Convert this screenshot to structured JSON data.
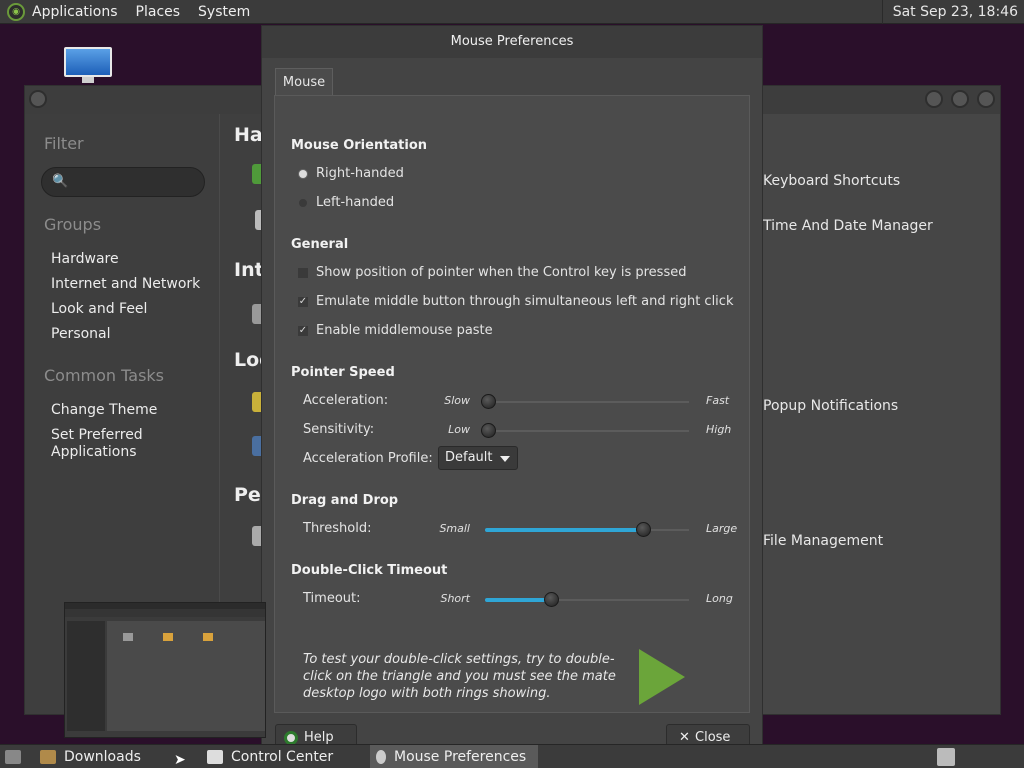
{
  "top_panel": {
    "menus": [
      "Applications",
      "Places",
      "System"
    ],
    "clock": "Sat Sep 23, 18:46"
  },
  "control_center": {
    "sidebar": {
      "filter_title": "Filter",
      "search_placeholder": "",
      "groups_title": "Groups",
      "groups": [
        "Hardware",
        "Internet and Network",
        "Look and Feel",
        "Personal"
      ],
      "common_tasks_title": "Common Tasks",
      "tasks": [
        "Change Theme",
        "Set Preferred\nApplications"
      ]
    },
    "headings": [
      "Har",
      "Inte",
      "Loo",
      "Per"
    ],
    "items": [
      "Keyboard Shortcuts",
      "Time And Date Manager",
      "Popup Notifications",
      "File Management"
    ]
  },
  "mouse_prefs": {
    "title": "Mouse Preferences",
    "tab": "Mouse",
    "orientation": {
      "title": "Mouse Orientation",
      "right": "Right-handed",
      "left": "Left-handed",
      "selected": "right"
    },
    "general": {
      "title": "General",
      "show_position": {
        "label": "Show position of pointer when the Control key is pressed",
        "checked": false
      },
      "emulate_middle": {
        "label": "Emulate middle button through simultaneous left and right click",
        "checked": true
      },
      "middle_paste": {
        "label": "Enable middlemouse paste",
        "checked": true
      }
    },
    "pointer_speed": {
      "title": "Pointer Speed",
      "acceleration": {
        "label": "Acceleration:",
        "min": "Slow",
        "max": "Fast",
        "value": 0.0
      },
      "sensitivity": {
        "label": "Sensitivity:",
        "min": "Low",
        "max": "High",
        "value": 0.0
      },
      "profile": {
        "label": "Acceleration Profile:",
        "value": "Default"
      }
    },
    "drag_drop": {
      "title": "Drag and Drop",
      "threshold": {
        "label": "Threshold:",
        "min": "Small",
        "max": "Large",
        "value": 0.78
      }
    },
    "double_click": {
      "title": "Double-Click Timeout",
      "timeout": {
        "label": "Timeout:",
        "min": "Short",
        "max": "Long",
        "value": 0.33
      },
      "test_text": "To test your double-click settings, try to double-click on the triangle and you must see the mate desktop logo with both rings showing."
    },
    "buttons": {
      "help": "Help",
      "close": "Close"
    }
  },
  "bottom_panel": {
    "tasks": [
      "Downloads",
      "Control Center",
      "Mouse Preferences"
    ]
  },
  "colors": {
    "accent": "#2fa6d6",
    "triangle": "#6ba53a"
  }
}
